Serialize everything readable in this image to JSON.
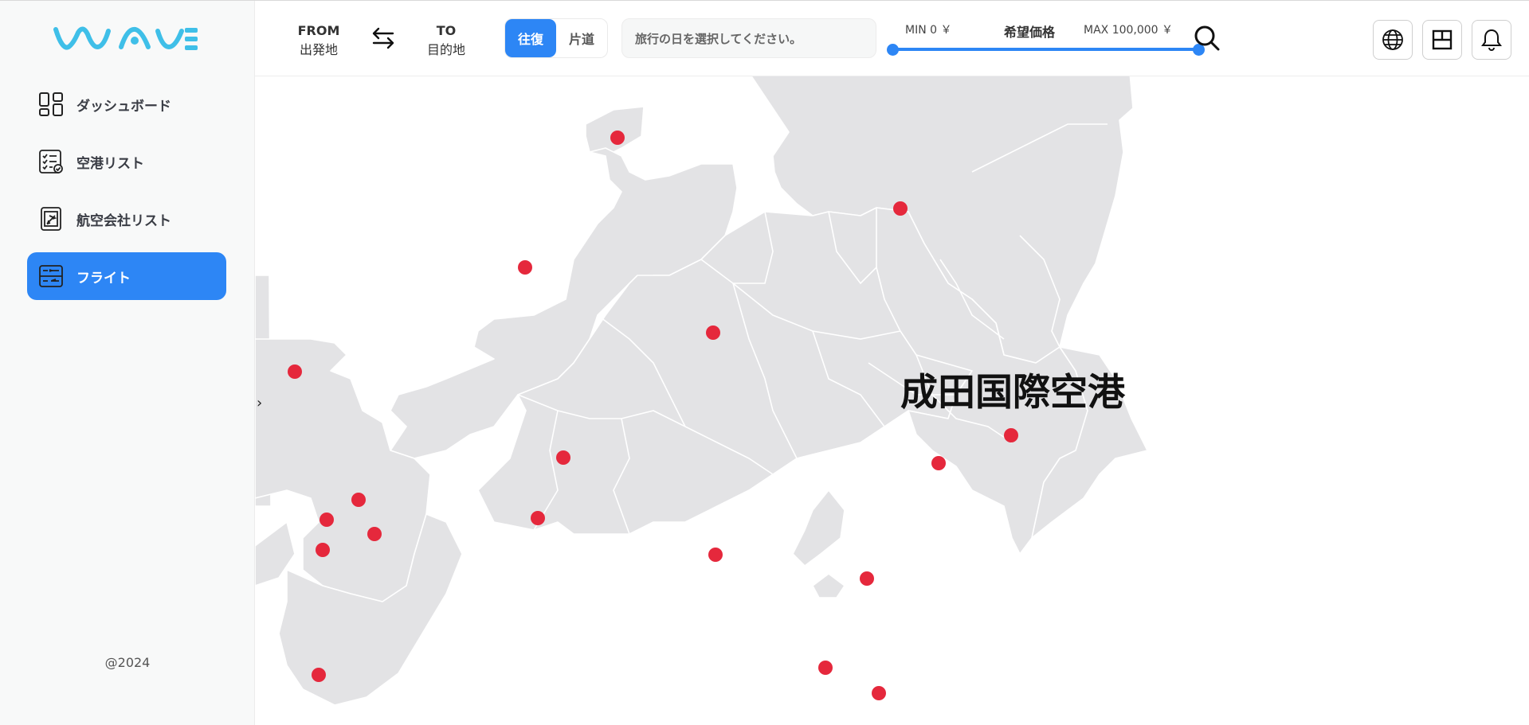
{
  "sidebar": {
    "logo_text": "WAVE",
    "items": [
      {
        "label": "ダッシュボード",
        "icon": "dashboard-icon"
      },
      {
        "label": "空港リスト",
        "icon": "checklist-icon"
      },
      {
        "label": "航空会社リスト",
        "icon": "airline-icon"
      },
      {
        "label": "フライト",
        "icon": "flight-board-icon",
        "active": true
      }
    ],
    "copyright": "@2024"
  },
  "header": {
    "from_label": "FROM",
    "from_sub": "出発地",
    "to_label": "TO",
    "to_sub": "目的地",
    "trip_round": "往復",
    "trip_oneway": "片道",
    "date_placeholder": "旅行の日を選択してください。",
    "price_min": "MIN 0 ￥",
    "price_title": "希望価格",
    "price_max": "MAX 100,000 ￥",
    "price_range_min_fraction": 0,
    "price_range_max_fraction": 1
  },
  "map": {
    "label": "成田国際空港",
    "airport_marker_color": "#e5283c",
    "land_color": "#e3e3e5"
  },
  "colors": {
    "accent": "#2d86f5",
    "logo": "#3fbfe8"
  }
}
